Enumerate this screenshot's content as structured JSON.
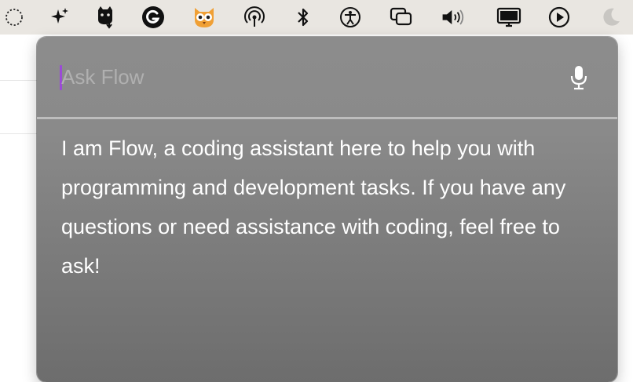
{
  "menubar": {
    "icons": [
      "dotted-circle-icon",
      "sparkle-icon",
      "cat-download-icon",
      "grammarly-icon",
      "owl-icon",
      "airdrop-icon",
      "bluetooth-icon",
      "accessibility-icon",
      "screen-mirroring-icon",
      "volume-icon",
      "display-icon",
      "play-icon",
      "moon-icon"
    ]
  },
  "panel": {
    "ask_placeholder": "Ask Flow",
    "ask_value": "",
    "response": "I am Flow, a coding assistant here to help you with programming and development tasks. If you have any questions or need assistance with coding, feel free to ask!"
  },
  "colors": {
    "caret": "#9b4bd6",
    "panel_bg": "#8a8a8a",
    "menubar_bg": "#e9e6e1",
    "owl": "#f0a035"
  }
}
